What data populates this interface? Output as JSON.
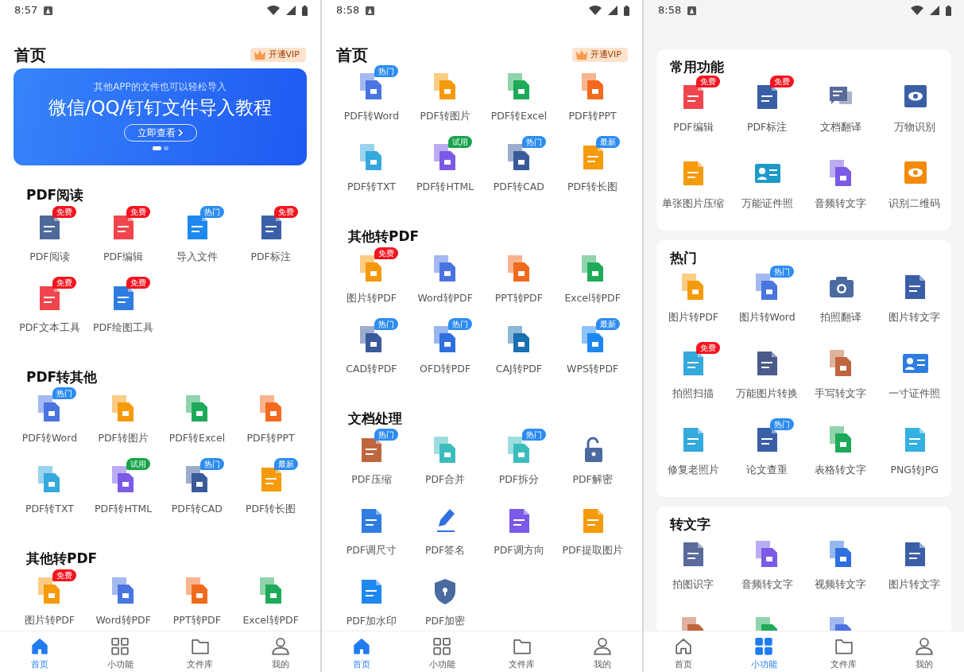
{
  "screens": [
    {
      "kind": "plain",
      "status_time": "8:57",
      "header": {
        "title": "首页",
        "vip": "开通VIP"
      },
      "banner": {
        "subtitle": "其他APP的文件也可以轻松导入",
        "title": "微信/QQ/钉钉文件导入教程",
        "button": "立即查看",
        "pages": [
          {
            "selected": true
          },
          {
            "selected": false
          }
        ]
      },
      "sections": [
        {
          "title": "PDF阅读",
          "items": [
            {
              "label": "PDF阅读",
              "icon": {
                "kind": "doc",
                "color": "#4e6a9a"
              },
              "badge": {
                "text": "免费",
                "color": "#f3141e"
              }
            },
            {
              "label": "PDF编辑",
              "icon": {
                "kind": "doc",
                "color": "#f0454c"
              },
              "badge": {
                "text": "免费",
                "color": "#f3141e"
              }
            },
            {
              "label": "导入文件",
              "icon": {
                "kind": "doc",
                "color": "#1e88f0"
              },
              "badge": {
                "text": "热门",
                "color": "#2d8cf0"
              }
            },
            {
              "label": "PDF标注",
              "icon": {
                "kind": "doc",
                "color": "#3b5fa6"
              },
              "badge": {
                "text": "免费",
                "color": "#f3141e"
              }
            },
            {
              "label": "PDF文本工具",
              "icon": {
                "kind": "doc",
                "color": "#f0454c"
              },
              "badge": {
                "text": "免费",
                "color": "#f3141e"
              }
            },
            {
              "label": "PDF绘图工具",
              "icon": {
                "kind": "doc",
                "color": "#2f7de0"
              },
              "badge": {
                "text": "免费",
                "color": "#f3141e"
              }
            }
          ]
        },
        {
          "title": "PDF转其他",
          "items": [
            {
              "label": "PDF转Word",
              "icon": {
                "kind": "pair",
                "color": "#4a74e0"
              },
              "badge": {
                "text": "热门",
                "color": "#2d8cf0"
              }
            },
            {
              "label": "PDF转图片",
              "icon": {
                "kind": "pair",
                "color": "#f59a0a"
              }
            },
            {
              "label": "PDF转Excel",
              "icon": {
                "kind": "pair",
                "color": "#1faa5a"
              }
            },
            {
              "label": "PDF转PPT",
              "icon": {
                "kind": "pair",
                "color": "#f26a1e"
              }
            },
            {
              "label": "PDF转TXT",
              "icon": {
                "kind": "pair",
                "color": "#35a8dc"
              }
            },
            {
              "label": "PDF转HTML",
              "icon": {
                "kind": "pair",
                "color": "#7a5ae6"
              },
              "badge": {
                "text": "试用",
                "color": "#17a34a"
              }
            },
            {
              "label": "PDF转CAD",
              "icon": {
                "kind": "pair",
                "color": "#3a5a9a"
              },
              "badge": {
                "text": "热门",
                "color": "#2d8cf0"
              }
            },
            {
              "label": "PDF转长图",
              "icon": {
                "kind": "doc",
                "color": "#f59a0a"
              },
              "badge": {
                "text": "最新",
                "color": "#2d8cf0"
              }
            }
          ]
        },
        {
          "title": "其他转PDF",
          "items": [
            {
              "label": "图片转PDF",
              "icon": {
                "kind": "pair",
                "color": "#f59a0a"
              },
              "badge": {
                "text": "免费",
                "color": "#f3141e"
              }
            },
            {
              "label": "Word转PDF",
              "icon": {
                "kind": "pair",
                "color": "#4a74e0"
              }
            },
            {
              "label": "PPT转PDF",
              "icon": {
                "kind": "pair",
                "color": "#f26a1e"
              }
            },
            {
              "label": "Excel转PDF",
              "icon": {
                "kind": "pair",
                "color": "#1faa5a"
              }
            }
          ]
        }
      ],
      "nav": [
        {
          "label": "首页",
          "selected": true
        },
        {
          "label": "小功能",
          "selected": false
        },
        {
          "label": "文件库",
          "selected": false
        },
        {
          "label": "我的",
          "selected": false
        }
      ]
    },
    {
      "kind": "plain",
      "status_time": "8:58",
      "header": {
        "title": "首页",
        "vip": "开通VIP"
      },
      "sections": [
        {
          "items": [
            {
              "label": "PDF转Word",
              "icon": {
                "kind": "pair",
                "color": "#4a74e0"
              },
              "badge": {
                "text": "热门",
                "color": "#2d8cf0"
              }
            },
            {
              "label": "PDF转图片",
              "icon": {
                "kind": "pair",
                "color": "#f59a0a"
              }
            },
            {
              "label": "PDF转Excel",
              "icon": {
                "kind": "pair",
                "color": "#1faa5a"
              }
            },
            {
              "label": "PDF转PPT",
              "icon": {
                "kind": "pair",
                "color": "#f26a1e"
              }
            },
            {
              "label": "PDF转TXT",
              "icon": {
                "kind": "pair",
                "color": "#35a8dc"
              }
            },
            {
              "label": "PDF转HTML",
              "icon": {
                "kind": "pair",
                "color": "#7a5ae6"
              },
              "badge": {
                "text": "试用",
                "color": "#17a34a"
              }
            },
            {
              "label": "PDF转CAD",
              "icon": {
                "kind": "pair",
                "color": "#3a5a9a"
              },
              "badge": {
                "text": "热门",
                "color": "#2d8cf0"
              }
            },
            {
              "label": "PDF转长图",
              "icon": {
                "kind": "doc",
                "color": "#f59a0a"
              },
              "badge": {
                "text": "最新",
                "color": "#2d8cf0"
              }
            }
          ]
        },
        {
          "title": "其他转PDF",
          "items": [
            {
              "label": "图片转PDF",
              "icon": {
                "kind": "pair",
                "color": "#f59a0a"
              },
              "badge": {
                "text": "免费",
                "color": "#f3141e"
              }
            },
            {
              "label": "Word转PDF",
              "icon": {
                "kind": "pair",
                "color": "#4a74e0"
              }
            },
            {
              "label": "PPT转PDF",
              "icon": {
                "kind": "pair",
                "color": "#f26a1e"
              }
            },
            {
              "label": "Excel转PDF",
              "icon": {
                "kind": "pair",
                "color": "#1faa5a"
              }
            },
            {
              "label": "CAD转PDF",
              "icon": {
                "kind": "pair",
                "color": "#3a5a9a"
              },
              "badge": {
                "text": "热门",
                "color": "#2d8cf0"
              }
            },
            {
              "label": "OFD转PDF",
              "icon": {
                "kind": "pair",
                "color": "#2f6fe0"
              },
              "badge": {
                "text": "热门",
                "color": "#2d8cf0"
              }
            },
            {
              "label": "CAJ转PDF",
              "icon": {
                "kind": "pair",
                "color": "#1a6fb0"
              }
            },
            {
              "label": "WPS转PDF",
              "icon": {
                "kind": "pair",
                "color": "#1e88f0"
              },
              "badge": {
                "text": "最新",
                "color": "#2d8cf0"
              }
            }
          ]
        },
        {
          "title": "文档处理",
          "items": [
            {
              "label": "PDF压缩",
              "icon": {
                "kind": "doc",
                "color": "#c0663e"
              },
              "badge": {
                "text": "热门",
                "color": "#2d8cf0"
              }
            },
            {
              "label": "PDF合并",
              "icon": {
                "kind": "pair",
                "color": "#3cbcbc"
              }
            },
            {
              "label": "PDF拆分",
              "icon": {
                "kind": "pair",
                "color": "#3cbcbc"
              },
              "badge": {
                "text": "热门",
                "color": "#2d8cf0"
              }
            },
            {
              "label": "PDF解密",
              "icon": {
                "kind": "lock",
                "color": "#4a6aa0"
              }
            },
            {
              "label": "PDF调尺寸",
              "icon": {
                "kind": "doc",
                "color": "#2f7de0"
              }
            },
            {
              "label": "PDF签名",
              "icon": {
                "kind": "pen",
                "color": "#2f6fe0"
              }
            },
            {
              "label": "PDF调方向",
              "icon": {
                "kind": "doc",
                "color": "#7a5ae6"
              }
            },
            {
              "label": "PDF提取图片",
              "icon": {
                "kind": "doc",
                "color": "#f59a0a"
              }
            },
            {
              "label": "PDF加水印",
              "icon": {
                "kind": "doc",
                "color": "#1e88f0"
              }
            },
            {
              "label": "PDF加密",
              "icon": {
                "kind": "shield",
                "color": "#4a6aa0"
              }
            }
          ]
        }
      ],
      "nav": [
        {
          "label": "首页",
          "selected": true
        },
        {
          "label": "小功能",
          "selected": false
        },
        {
          "label": "文件库",
          "selected": false
        },
        {
          "label": "我的",
          "selected": false
        }
      ]
    },
    {
      "kind": "cards",
      "status_time": "8:58",
      "sections": [
        {
          "title": "常用功能",
          "items": [
            {
              "label": "PDF编辑",
              "icon": {
                "kind": "doc",
                "color": "#f0454c"
              },
              "badge": {
                "text": "免费",
                "color": "#f3141e"
              }
            },
            {
              "label": "PDF标注",
              "icon": {
                "kind": "doc",
                "color": "#3b5fa6"
              },
              "badge": {
                "text": "免费",
                "color": "#f3141e"
              }
            },
            {
              "label": "文档翻译",
              "icon": {
                "kind": "chat",
                "color": "#5a6a9a"
              }
            },
            {
              "label": "万物识别",
              "icon": {
                "kind": "eye",
                "color": "#3b5fa6"
              }
            },
            {
              "label": "单张图片压缩",
              "icon": {
                "kind": "doc",
                "color": "#f59a0a"
              }
            },
            {
              "label": "万能证件照",
              "icon": {
                "kind": "card",
                "color": "#1e9ac8"
              }
            },
            {
              "label": "音频转文字",
              "icon": {
                "kind": "pair",
                "color": "#7a5ae6"
              }
            },
            {
              "label": "识别二维码",
              "icon": {
                "kind": "eye",
                "color": "#f58a0a"
              }
            }
          ]
        },
        {
          "title": "热门",
          "items": [
            {
              "label": "图片转PDF",
              "icon": {
                "kind": "pair",
                "color": "#f59a0a"
              }
            },
            {
              "label": "图片转Word",
              "icon": {
                "kind": "pair",
                "color": "#4a74e0"
              },
              "badge": {
                "text": "热门",
                "color": "#2d8cf0"
              }
            },
            {
              "label": "拍照翻译",
              "icon": {
                "kind": "camera",
                "color": "#4a6aa0"
              }
            },
            {
              "label": "图片转文字",
              "icon": {
                "kind": "doc",
                "color": "#3b5fa6"
              }
            },
            {
              "label": "拍照扫描",
              "icon": {
                "kind": "doc",
                "color": "#35a8dc"
              },
              "badge": {
                "text": "免费",
                "color": "#f3141e"
              }
            },
            {
              "label": "万能图片转换",
              "icon": {
                "kind": "doc",
                "color": "#4a5a8a"
              }
            },
            {
              "label": "手写转文字",
              "icon": {
                "kind": "pair",
                "color": "#c0663e"
              }
            },
            {
              "label": "一寸证件照",
              "icon": {
                "kind": "card",
                "color": "#2f7de0"
              }
            },
            {
              "label": "修复老照片",
              "icon": {
                "kind": "doc",
                "color": "#35a8dc"
              }
            },
            {
              "label": "论文查重",
              "icon": {
                "kind": "doc",
                "color": "#3b5fa6"
              },
              "badge": {
                "text": "热门",
                "color": "#2d8cf0"
              }
            },
            {
              "label": "表格转文字",
              "icon": {
                "kind": "pair",
                "color": "#1faa5a"
              }
            },
            {
              "label": "PNG转JPG",
              "icon": {
                "kind": "doc",
                "color": "#35b0e0"
              }
            }
          ]
        },
        {
          "title": "转文字",
          "items": [
            {
              "label": "拍图识字",
              "icon": {
                "kind": "doc",
                "color": "#5a6a9a"
              }
            },
            {
              "label": "音频转文字",
              "icon": {
                "kind": "pair",
                "color": "#7a5ae6"
              }
            },
            {
              "label": "视频转文字",
              "icon": {
                "kind": "pair",
                "color": "#2f6fe0"
              }
            },
            {
              "label": "图片转文字",
              "icon": {
                "kind": "doc",
                "color": "#3b5fa6"
              }
            },
            {
              "icon": {
                "kind": "pair",
                "color": "#c0663e"
              }
            },
            {
              "icon": {
                "kind": "pair",
                "color": "#1faa5a"
              }
            },
            {
              "icon": {
                "kind": "pair",
                "color": "#4a74e0"
              }
            }
          ]
        }
      ],
      "nav": [
        {
          "label": "首页",
          "selected": false
        },
        {
          "label": "小功能",
          "selected": true
        },
        {
          "label": "文件库",
          "selected": false
        },
        {
          "label": "我的",
          "selected": false
        }
      ]
    }
  ]
}
